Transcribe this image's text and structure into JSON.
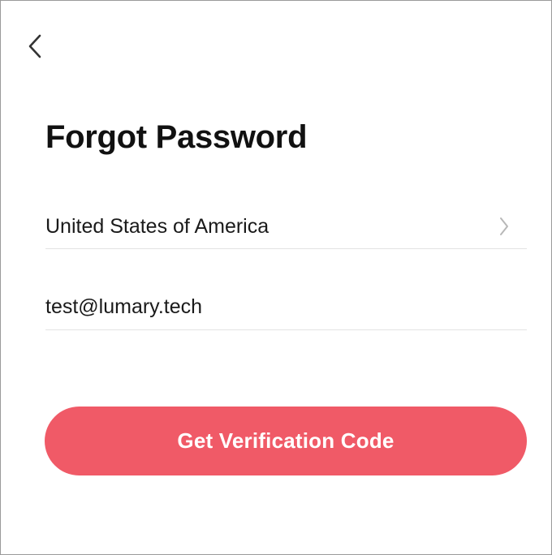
{
  "header": {
    "back_icon": "chevron-left-icon"
  },
  "page": {
    "title": "Forgot Password"
  },
  "form": {
    "country": {
      "value": "United States of America",
      "icon": "chevron-right-icon"
    },
    "email": {
      "value": "test@lumary.tech",
      "placeholder": ""
    },
    "submit_label": "Get Verification Code"
  },
  "colors": {
    "accent": "#f05a67",
    "divider": "#e3e3e3",
    "chevron": "#b8b8b8",
    "text": "#111111"
  }
}
